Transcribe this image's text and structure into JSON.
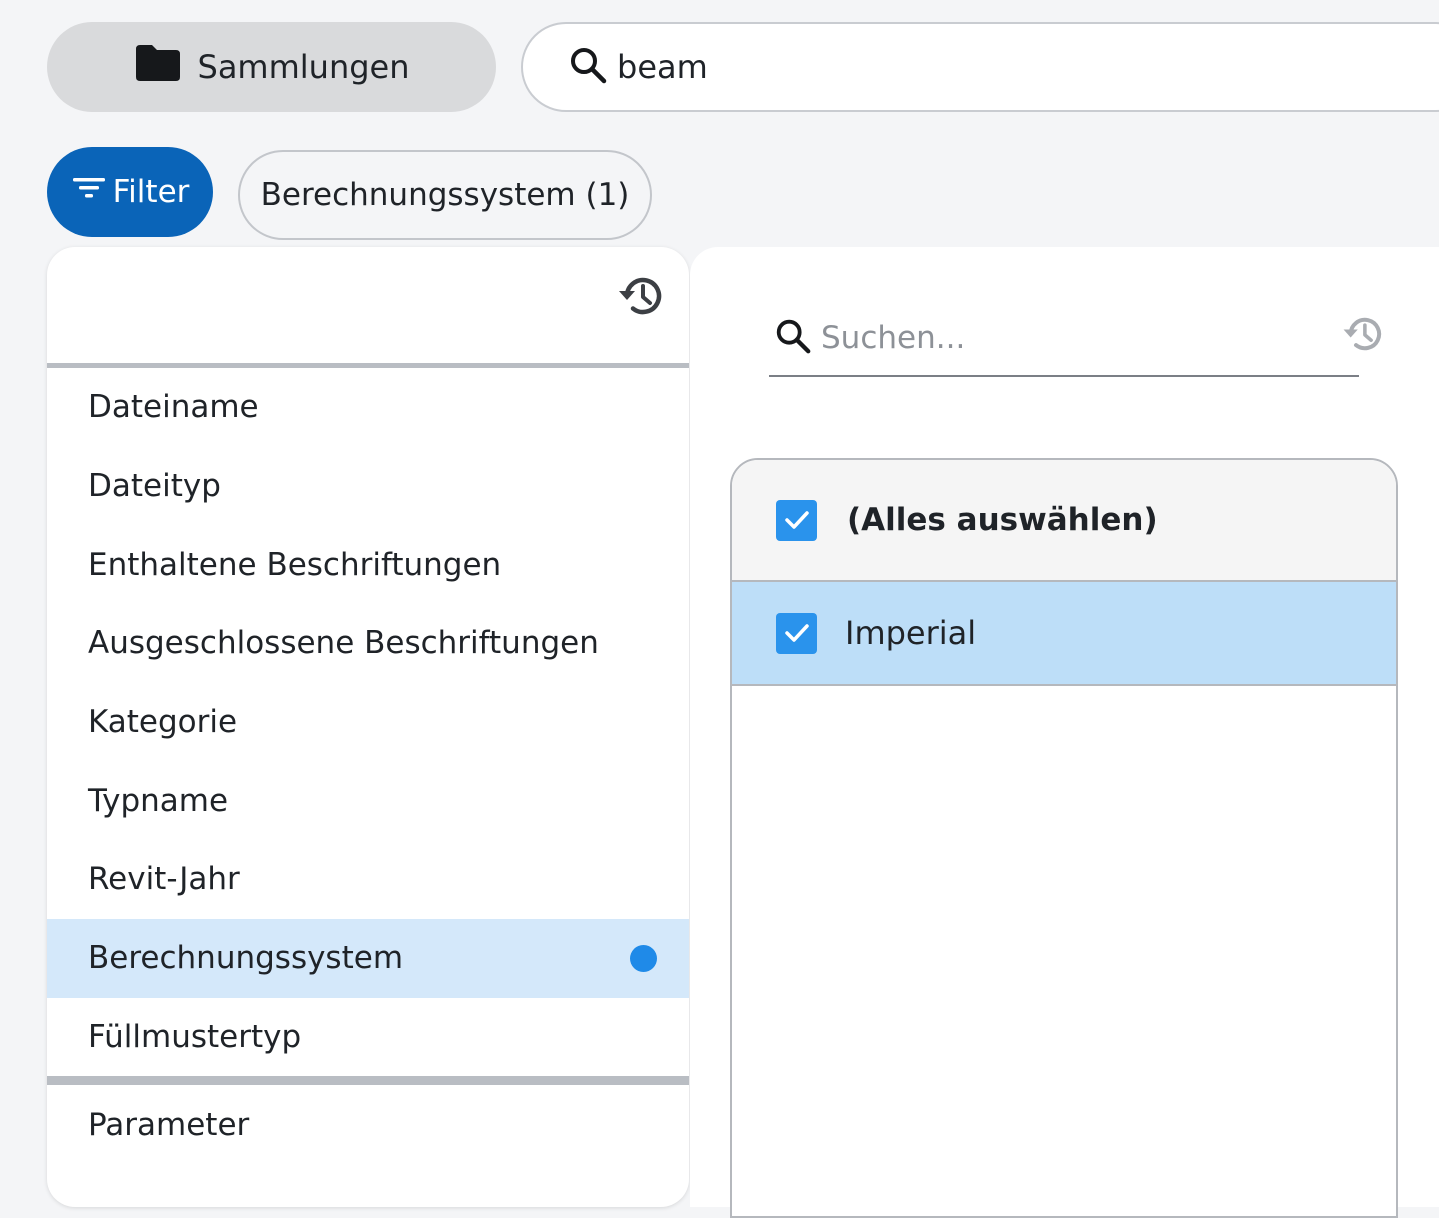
{
  "header": {
    "collections_label": "Sammlungen",
    "search_value": "beam"
  },
  "toolbar": {
    "filter_label": "Filter",
    "active_chip_label": "Berechnungssystem (1)"
  },
  "fields": {
    "items": [
      {
        "label": "Dateiname"
      },
      {
        "label": "Dateityp"
      },
      {
        "label": "Enthaltene Beschriftungen"
      },
      {
        "label": "Ausgeschlossene Beschriftungen"
      },
      {
        "label": "Kategorie"
      },
      {
        "label": "Typname"
      },
      {
        "label": "Revit-Jahr"
      },
      {
        "label": "Berechnungssystem"
      },
      {
        "label": "Füllmustertyp"
      }
    ],
    "parameter_label": "Parameter"
  },
  "values": {
    "search_placeholder": "Suchen...",
    "select_all_label": "(Alles auswählen)",
    "items": [
      {
        "label": "Imperial"
      }
    ]
  },
  "colors": {
    "accent": "#0a64b8",
    "selected_row": "#d4e8fa",
    "checked_row": "#bddef8",
    "checkbox": "#2a93ec",
    "active_dot": "#1f8ae8"
  }
}
